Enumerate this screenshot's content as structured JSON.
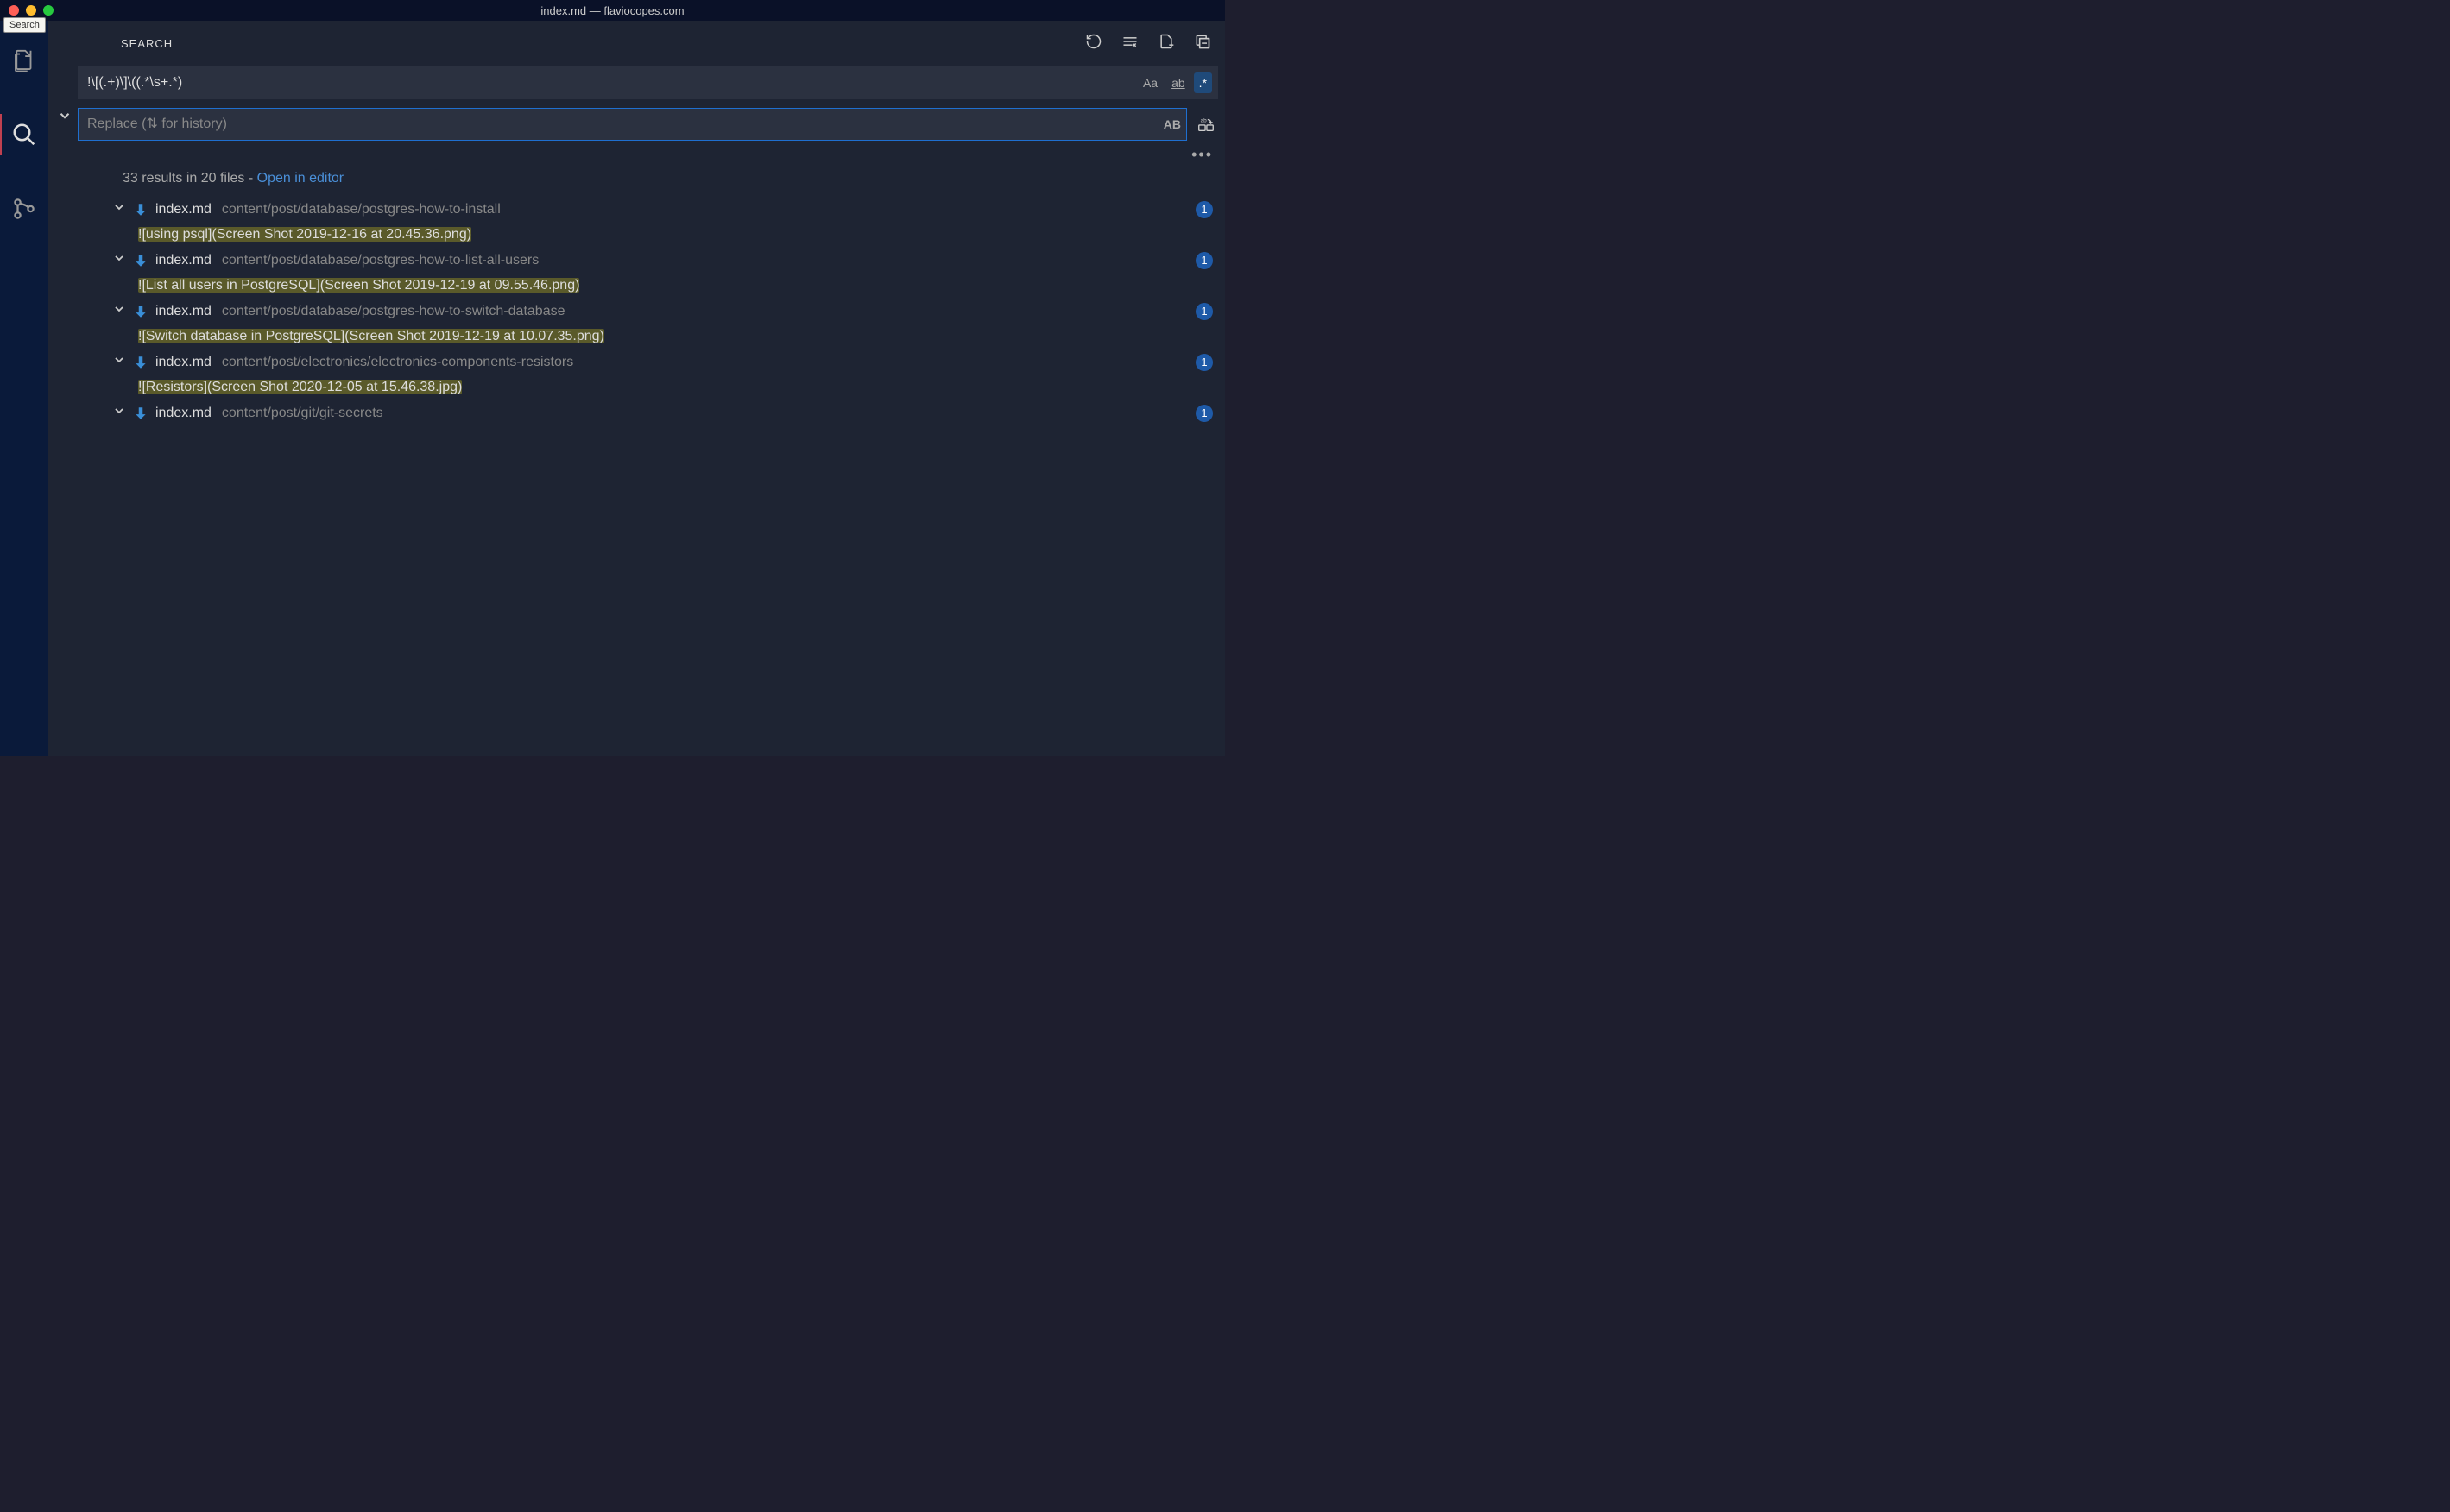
{
  "window": {
    "title": "index.md — flaviocopes.com",
    "tooltip": "Search"
  },
  "panel": {
    "title": "SEARCH"
  },
  "search": {
    "value": "!\\[(.+)\\]\\((.*\\s+.*)",
    "match_case_symbol": "Aa",
    "whole_word_symbol": "ab",
    "regex_symbol": ".*"
  },
  "replace": {
    "placeholder": "Replace (⇅ for history)",
    "preserve_case_symbol": "AB"
  },
  "summary": {
    "text": "33 results in 20 files - ",
    "link": "Open in editor"
  },
  "results": [
    {
      "filename": "index.md",
      "path": "content/post/database/postgres-how-to-install",
      "count": "1",
      "match": "![using psql](Screen Shot 2019-12-16 at 20.45.36.png)"
    },
    {
      "filename": "index.md",
      "path": "content/post/database/postgres-how-to-list-all-users",
      "count": "1",
      "match": "![List all users in PostgreSQL](Screen Shot 2019-12-19 at 09.55.46.png)"
    },
    {
      "filename": "index.md",
      "path": "content/post/database/postgres-how-to-switch-database",
      "count": "1",
      "match": "![Switch database in PostgreSQL](Screen Shot 2019-12-19 at 10.07.35.png)"
    },
    {
      "filename": "index.md",
      "path": "content/post/electronics/electronics-components-resistors",
      "count": "1",
      "match": "![Resistors](Screen Shot 2020-12-05 at 15.46.38.jpg)"
    },
    {
      "filename": "index.md",
      "path": "content/post/git/git-secrets",
      "count": "1",
      "match": ""
    }
  ]
}
